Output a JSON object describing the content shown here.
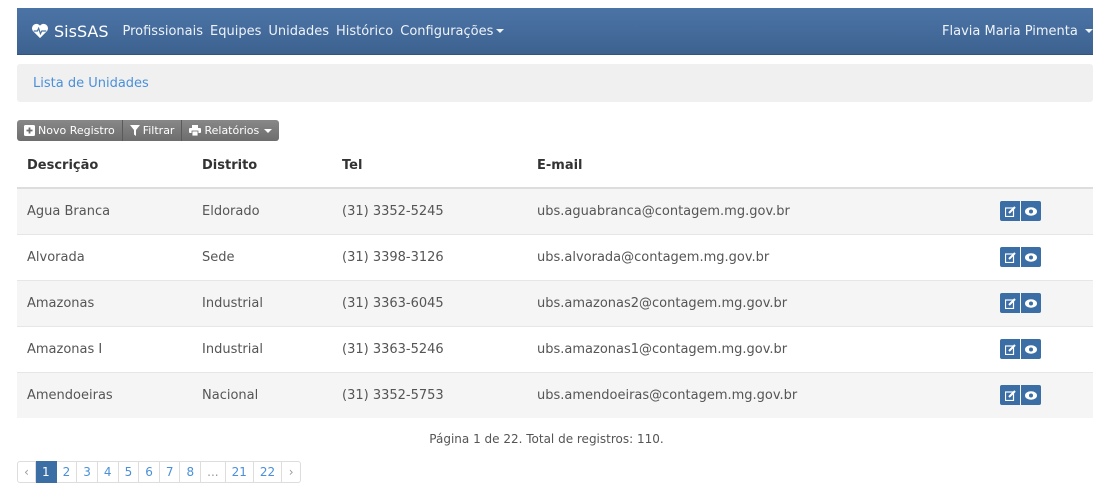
{
  "colors": {
    "navbar": "#4b74a6",
    "primary": "#3a6ea5",
    "link": "#4a90d9",
    "toolbar_button": "#7a7a7a",
    "row_stripe": "#f5f5f5"
  },
  "navbar": {
    "brand": "SisSAS",
    "brand_icon": "heart-pulse-icon",
    "links": [
      "Profissionais",
      "Equipes",
      "Unidades",
      "Histórico"
    ],
    "config_label": "Configurações",
    "user_name": "Flavia Maria Pimenta"
  },
  "breadcrumb": {
    "current": "Lista de Unidades"
  },
  "toolbar": {
    "new_label": "Novo Registro",
    "filter_label": "Filtrar",
    "reports_label": "Relatórios"
  },
  "table": {
    "headers": {
      "descricao": "Descrição",
      "distrito": "Distrito",
      "tel": "Tel",
      "email": "E-mail"
    },
    "rows": [
      {
        "descricao": "Agua Branca",
        "distrito": "Eldorado",
        "tel": "(31) 3352-5245",
        "email": "ubs.aguabranca@contagem.mg.gov.br"
      },
      {
        "descricao": "Alvorada",
        "distrito": "Sede",
        "tel": "(31) 3398-3126",
        "email": "ubs.alvorada@contagem.mg.gov.br"
      },
      {
        "descricao": "Amazonas",
        "distrito": "Industrial",
        "tel": "(31) 3363-6045",
        "email": "ubs.amazonas2@contagem.mg.gov.br"
      },
      {
        "descricao": "Amazonas I",
        "distrito": "Industrial",
        "tel": "(31) 3363-5246",
        "email": "ubs.amazonas1@contagem.mg.gov.br"
      },
      {
        "descricao": "Amendoeiras",
        "distrito": "Nacional",
        "tel": "(31) 3352-5753",
        "email": "ubs.amendoeiras@contagem.mg.gov.br"
      }
    ]
  },
  "pagination": {
    "info": "Página 1 de 22. Total de registros: 110.",
    "prev": "‹",
    "next": "›",
    "pages": [
      "1",
      "2",
      "3",
      "4",
      "5",
      "6",
      "7",
      "8",
      "...",
      "21",
      "22"
    ],
    "current_page": "1"
  }
}
